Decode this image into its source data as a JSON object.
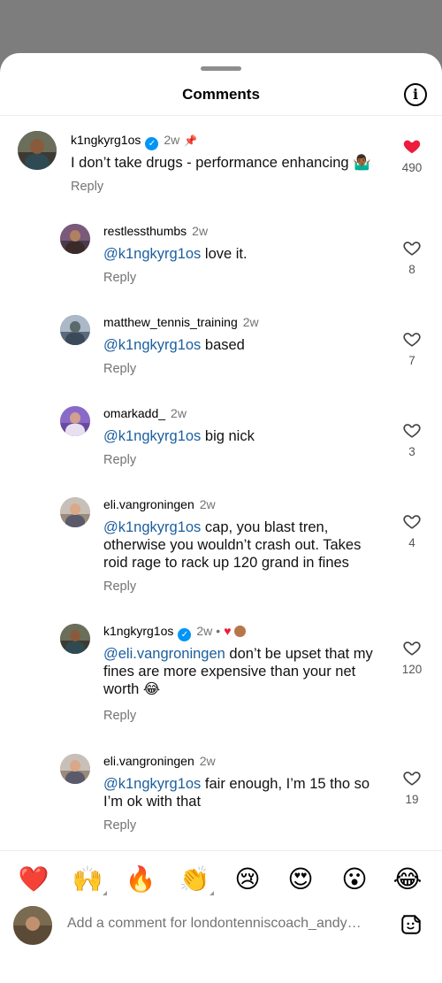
{
  "header": {
    "title": "Comments",
    "info_icon": "i"
  },
  "comments": [
    {
      "username": "k1ngkyrg1os",
      "verified": true,
      "pinned": true,
      "time": "2w",
      "mention": "",
      "text": "I don’t take drugs - performance enhancing 🤷🏾‍♂️",
      "reply": "Reply",
      "likes": "490",
      "liked": true
    },
    {
      "username": "restlessthumbs",
      "time": "2w",
      "mention": "@k1ngkyrg1os",
      "text": " love it.",
      "reply": "Reply",
      "likes": "8"
    },
    {
      "username": "matthew_tennis_training",
      "time": "2w",
      "mention": "@k1ngkyrg1os",
      "text": " based",
      "reply": "Reply",
      "likes": "7"
    },
    {
      "username": "omarkadd_",
      "time": "2w",
      "mention": "@k1ngkyrg1os",
      "text": " big nick",
      "reply": "Reply",
      "likes": "3"
    },
    {
      "username": "eli.vangroningen",
      "time": "2w",
      "mention": "@k1ngkyrg1os",
      "text": " cap, you blast tren, otherwise you wouldn’t crash out. Takes roid rage to rack up 120 grand in fines",
      "reply": "Reply",
      "likes": "4"
    },
    {
      "username": "k1ngkyrg1os",
      "verified": true,
      "time": "2w",
      "liked_by_creator": true,
      "mention": "@eli.vangroningen",
      "text": " don’t be upset that my fines are more expensive than your net worth 😂",
      "reply": "Reply",
      "likes": "120"
    },
    {
      "username": "eli.vangroningen",
      "time": "2w",
      "mention": "@k1ngkyrg1os",
      "text": " fair enough, I’m 15 tho so I’m ok with that",
      "reply": "Reply",
      "likes": "19"
    }
  ],
  "quick_reactions": [
    "❤️",
    "🙌",
    "🔥",
    "👏",
    "😢",
    "😍",
    "😮",
    "😂"
  ],
  "composer": {
    "placeholder": "Add a comment for londontenniscoach_andy…"
  },
  "colors": {
    "mention": "#1b5e9e",
    "liked_heart": "#ed1c3c",
    "verified": "#0095f6",
    "overlay": "#7d7d7d"
  }
}
